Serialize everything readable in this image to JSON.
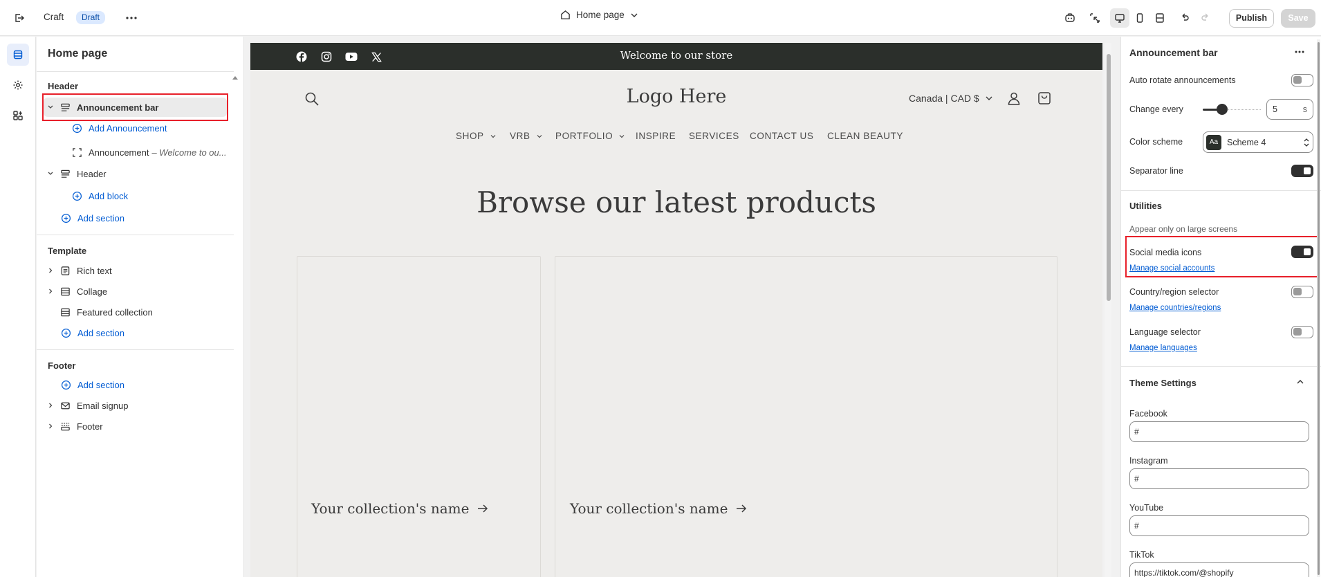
{
  "topbar": {
    "app_name": "Craft",
    "status_badge": "Draft",
    "page_selector": "Home page",
    "publish_label": "Publish",
    "save_label": "Save"
  },
  "sidebar": {
    "title": "Home page",
    "header_group": "Header",
    "announcement_bar": "Announcement bar",
    "add_announcement": "Add Announcement",
    "announcement_item": "Announcement",
    "announcement_item_detail": "– Welcome to ou...",
    "header_section": "Header",
    "add_block": "Add block",
    "add_section": "Add section",
    "template_group": "Template",
    "template_items": [
      "Rich text",
      "Collage",
      "Featured collection"
    ],
    "footer_group": "Footer",
    "footer_items": [
      "Email signup",
      "Footer"
    ]
  },
  "preview": {
    "announcement_text": "Welcome to our store",
    "logo": "Logo Here",
    "locale": "Canada | CAD $",
    "nav": [
      "SHOP",
      "VRB",
      "PORTFOLIO",
      "INSPIRE",
      "SERVICES",
      "CONTACT US",
      "CLEAN BEAUTY"
    ],
    "heading": "Browse our latest products",
    "collection_name": "Your collection's name"
  },
  "panel": {
    "title": "Announcement bar",
    "auto_rotate": "Auto rotate announcements",
    "change_every": "Change every",
    "change_every_value": "5",
    "change_every_unit": "s",
    "slider_fraction": 0.33,
    "color_scheme_label": "Color scheme",
    "color_scheme_value": "Scheme 4",
    "color_scheme_swatch": "Aa",
    "separator_line": "Separator line",
    "utilities_head": "Utilities",
    "large_screens_note": "Appear only on large screens",
    "social_icons": "Social media icons",
    "manage_social": "Manage social accounts",
    "country_selector": "Country/region selector",
    "manage_countries": "Manage countries/regions",
    "language_selector": "Language selector",
    "manage_languages": "Manage languages",
    "theme_settings": "Theme Settings",
    "facebook_label": "Facebook",
    "facebook_value": "#",
    "instagram_label": "Instagram",
    "instagram_value": "#",
    "youtube_label": "YouTube",
    "youtube_value": "#",
    "tiktok_label": "TikTok",
    "tiktok_value": "https://tiktok.com/@shopify"
  },
  "colors": {
    "accent": "#005bd3",
    "highlight": "#e8202a",
    "announcement_bg": "#2b2f2b"
  }
}
